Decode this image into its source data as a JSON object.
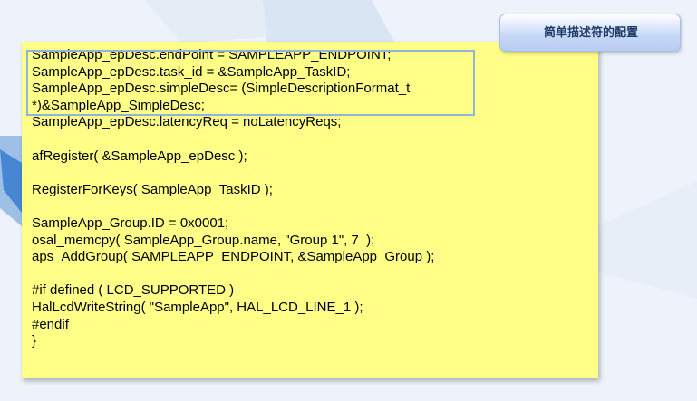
{
  "callout": {
    "label": "简单描述符的配置"
  },
  "code_lines": [
    "SampleApp_epDesc.endPoint = SAMPLEAPP_ENDPOINT;",
    "SampleApp_epDesc.task_id = &SampleApp_TaskID;",
    "SampleApp_epDesc.simpleDesc= (SimpleDescriptionFormat_t",
    "*)&SampleApp_SimpleDesc;",
    "SampleApp_epDesc.latencyReq = noLatencyReqs;",
    "",
    "afRegister( &SampleApp_epDesc );",
    "",
    "RegisterForKeys( SampleApp_TaskID );",
    "",
    "SampleApp_Group.ID = 0x0001;",
    "osal_memcpy( SampleApp_Group.name, \"Group 1\", 7  );",
    "aps_AddGroup( SAMPLEAPP_ENDPOINT, &SampleApp_Group );",
    "",
    "#if defined ( LCD_SUPPORTED )",
    "HalLcdWriteString( \"SampleApp\", HAL_LCD_LINE_1 );",
    "#endif",
    "}"
  ],
  "colors": {
    "background": "#eef3fb",
    "note_fill": "#ffff88",
    "highlight_border": "#8fb5dd",
    "callout_fill": "#c5d7f6",
    "callout_text": "#1f3a66"
  }
}
